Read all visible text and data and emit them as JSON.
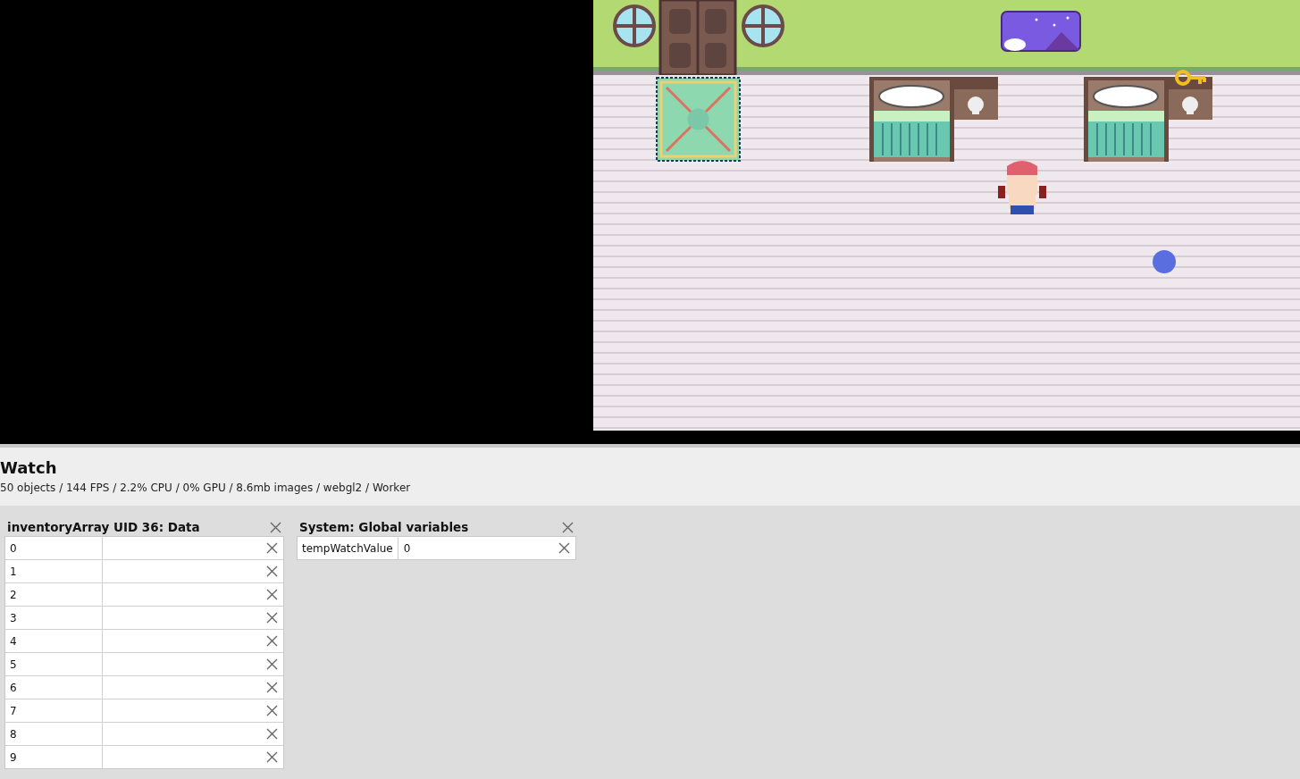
{
  "watch": {
    "title": "Watch",
    "stats": "50 objects / 144 FPS / 2.2% CPU / 0% GPU / 8.6mb images / webgl2 / Worker"
  },
  "panels": [
    {
      "title": "inventoryArray UID 36: Data",
      "rows": [
        {
          "key": "0"
        },
        {
          "key": "1"
        },
        {
          "key": "2"
        },
        {
          "key": "3"
        },
        {
          "key": "4"
        },
        {
          "key": "5"
        },
        {
          "key": "6"
        },
        {
          "key": "7"
        },
        {
          "key": "8"
        },
        {
          "key": "9"
        }
      ]
    },
    {
      "title": "System: Global variables",
      "rows": [
        {
          "key": "tempWatchValue",
          "value": "0"
        }
      ]
    }
  ]
}
